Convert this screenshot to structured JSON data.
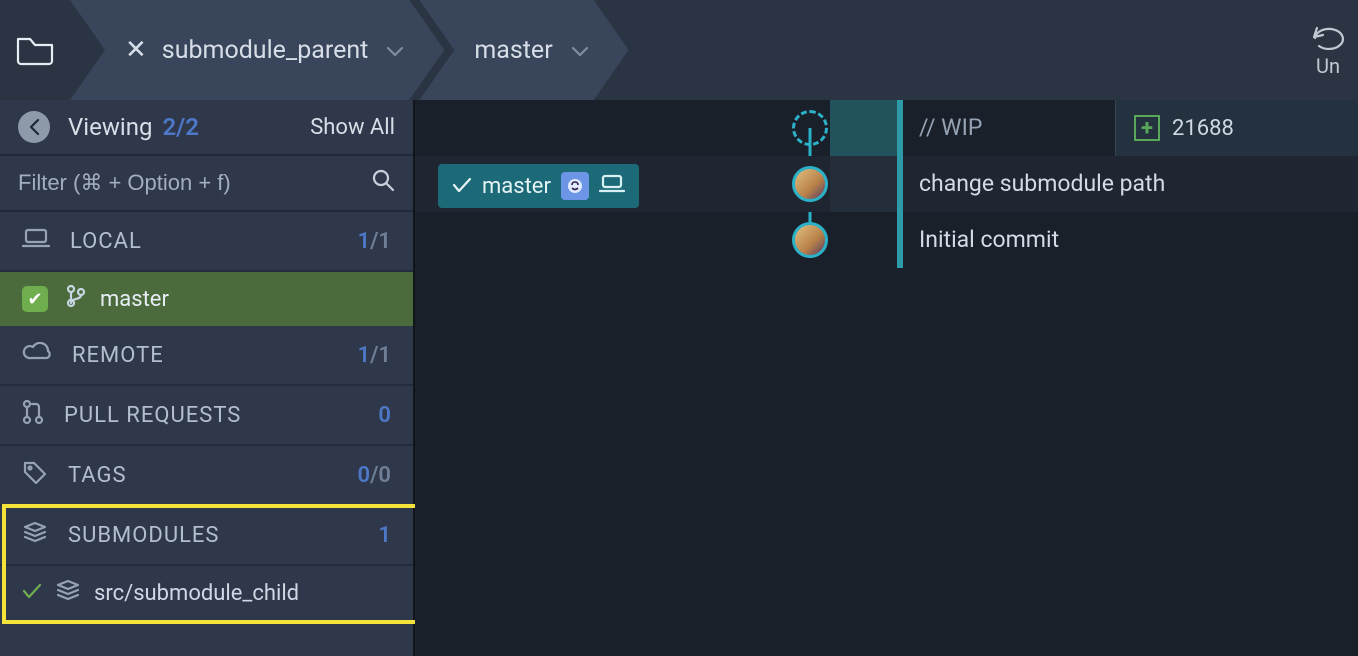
{
  "topbar": {
    "repo": "submodule_parent",
    "branch": "master",
    "undo": "Un"
  },
  "sidebar": {
    "viewing": "Viewing",
    "count": "2/2",
    "show_all": "Show All",
    "filter_placeholder": "Filter (⌘ + Option + f)",
    "sections": {
      "local": {
        "label": "LOCAL",
        "count_a": "1",
        "count_b": "/1"
      },
      "remote": {
        "label": "REMOTE",
        "count_a": "1",
        "count_b": "/1"
      },
      "pull": {
        "label": "PULL REQUESTS",
        "count_a": "0"
      },
      "tags": {
        "label": "TAGS",
        "count_a": "0",
        "count_b": "/0"
      },
      "sub": {
        "label": "SUBMODULES",
        "count_a": "1"
      }
    },
    "branch": "master",
    "submodule": "src/submodule_child"
  },
  "graph": {
    "wip": "// WIP",
    "hash": "21688",
    "tag_branch": "master",
    "commits": [
      {
        "msg": "change submodule path"
      },
      {
        "msg": "Initial commit"
      }
    ]
  }
}
